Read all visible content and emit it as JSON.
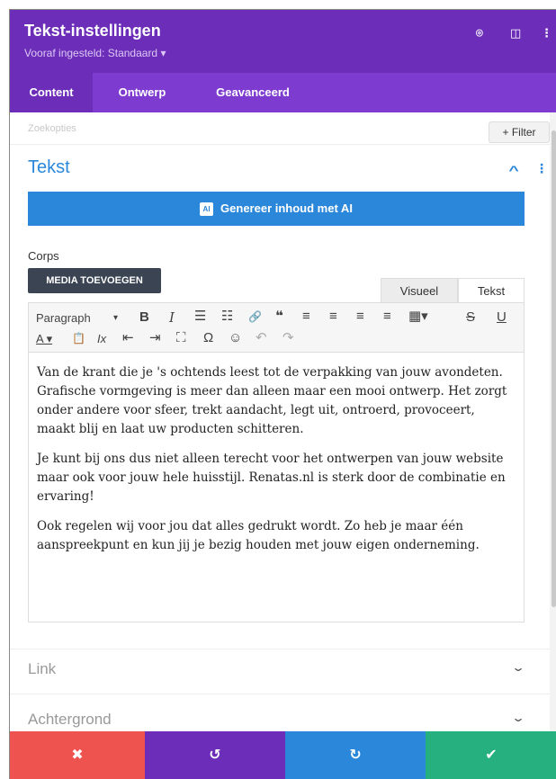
{
  "header": {
    "title": "Tekst-instellingen",
    "preset": "Vooraf ingesteld: Standaard ▾",
    "icons": [
      "expand-icon",
      "sidebar-layout-icon",
      "more-options-icon"
    ],
    "icon_glyphs": [
      "⌾",
      "◫",
      "⋮"
    ]
  },
  "tabs": [
    {
      "label": "Content",
      "active": true
    },
    {
      "label": "Ontwerp",
      "active": false
    },
    {
      "label": "Geavanceerd",
      "active": false
    }
  ],
  "search": {
    "placeholder": "Zoekopties"
  },
  "filter_button": "+ Filter",
  "text_section": {
    "title": "Tekst",
    "collapse_glyph": "^",
    "more_glyph": "⋮"
  },
  "ai_button": {
    "badge": "AI",
    "label": "Genereer inhoud met AI"
  },
  "corps_label": "Corps",
  "media_button": "MEDIA TOEVOEGEN",
  "editor_tabs": {
    "visual": "Visueel",
    "text": "Tekst"
  },
  "toolbar": {
    "paragraph": "Paragraph",
    "paragraph_caret": "▾",
    "bold": "B",
    "italic": "I",
    "bullet_list": "☰",
    "numbered_list": "☷",
    "link": "🔗",
    "quote": "❝",
    "align_left": "≡",
    "align_center": "≡",
    "align_right": "≡",
    "justify": "≡",
    "table": "▦▾",
    "strikethrough": "S",
    "underline": "U",
    "text_color": "A ▾",
    "paste_text": "📋",
    "clear_format": "Ix",
    "outdent": "⇤",
    "indent": "⇥",
    "fullscreen": "⛶",
    "special_char": "Ω",
    "emoji": "☺",
    "undo": "↶",
    "redo": "↷"
  },
  "content": {
    "paragraphs": [
      "Van de krant die je 's ochtends leest tot de verpakking van jouw avondeten. Grafische vormgeving is meer dan alleen maar een mooi ontwerp. Het zorgt onder andere voor sfeer, trekt aandacht, legt uit, ontroerd, provoceert, maakt blij en laat uw producten schitteren.",
      "Je kunt bij ons dus niet alleen terecht voor het ontwerpen van jouw website maar ook voor jouw hele huisstijl. Renatas.nl is sterk door de combinatie en ervaring!",
      "Ook regelen wij voor jou dat alles gedrukt wordt. Zo heb je maar één aanspreekpunt en kun jij je bezig houden met jouw eigen onderneming."
    ]
  },
  "collapsed_sections": [
    {
      "title": "Link",
      "chevron": "⌄"
    },
    {
      "title": "Achtergrond",
      "chevron": "⌄"
    }
  ],
  "bottom_bar": {
    "discard": "✖",
    "undo": "↺",
    "redo": "↻",
    "save": "✔"
  },
  "colors": {
    "header": "#6c2eb9",
    "tabs": "#7e3bd0",
    "accent": "#2b87da",
    "media_button": "#3b4452",
    "discard": "#ef5350",
    "undo": "#6c2eb9",
    "redo": "#2b87da",
    "save": "#26b07f"
  }
}
